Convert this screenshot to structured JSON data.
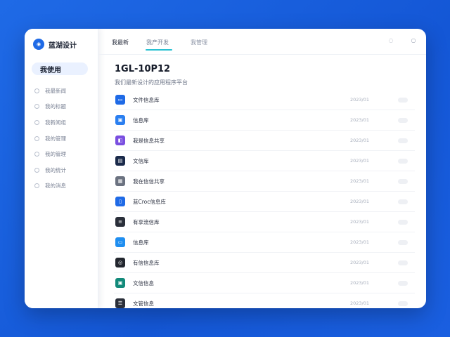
{
  "brand": {
    "name": "蓝湖设计",
    "logo_icon": "chat-bubble-icon",
    "accent": "#1f6ae6"
  },
  "sidebar": {
    "active_label": "我使用",
    "items": [
      {
        "label": "我最新闻"
      },
      {
        "label": "我的标题"
      },
      {
        "label": "我新闻组"
      },
      {
        "label": "我的管理"
      },
      {
        "label": "我的管理"
      },
      {
        "label": "我的统计"
      },
      {
        "label": "我的消息"
      }
    ]
  },
  "tabs": [
    {
      "label": "我最新"
    },
    {
      "label": "我产开发"
    },
    {
      "label": "我管理"
    }
  ],
  "header_icons": [
    "settings-icon",
    "search-icon",
    "more-icon"
  ],
  "main": {
    "title": "1GL-10P12",
    "subtitle": "我们最新设计的应用程序平台"
  },
  "rows": [
    {
      "name": "文件信息库",
      "value": "2023/01",
      "icon": "chat-icon",
      "color": "#1f6ae6"
    },
    {
      "name": "信息库",
      "value": "2023/01",
      "icon": "image-icon",
      "color": "#2b7ff0"
    },
    {
      "name": "我是信息共享",
      "value": "2023/01",
      "icon": "share-icon",
      "color": "#7a4fe0"
    },
    {
      "name": "文信库",
      "value": "2023/01",
      "icon": "document-icon",
      "color": "#1a2a4a"
    },
    {
      "name": "我在信信共享",
      "value": "2023/01",
      "icon": "folder-icon",
      "color": "#6b7280"
    },
    {
      "name": "蓝Croc信息库",
      "value": "2023/01",
      "icon": "file-icon",
      "color": "#1f6ae6"
    },
    {
      "name": "有享流信库",
      "value": "2023/01",
      "icon": "notes-icon",
      "color": "#2a2f3a"
    },
    {
      "name": "信息库",
      "value": "2023/01",
      "icon": "message-icon",
      "color": "#1f8ef0"
    },
    {
      "name": "有信信息库",
      "value": "2023/01",
      "icon": "target-icon",
      "color": "#22262e"
    },
    {
      "name": "文信信息",
      "value": "2023/01",
      "icon": "box-icon",
      "color": "#138a7a"
    },
    {
      "name": "文管信息",
      "value": "2023/01",
      "icon": "list-icon",
      "color": "#2a2f3a"
    }
  ]
}
